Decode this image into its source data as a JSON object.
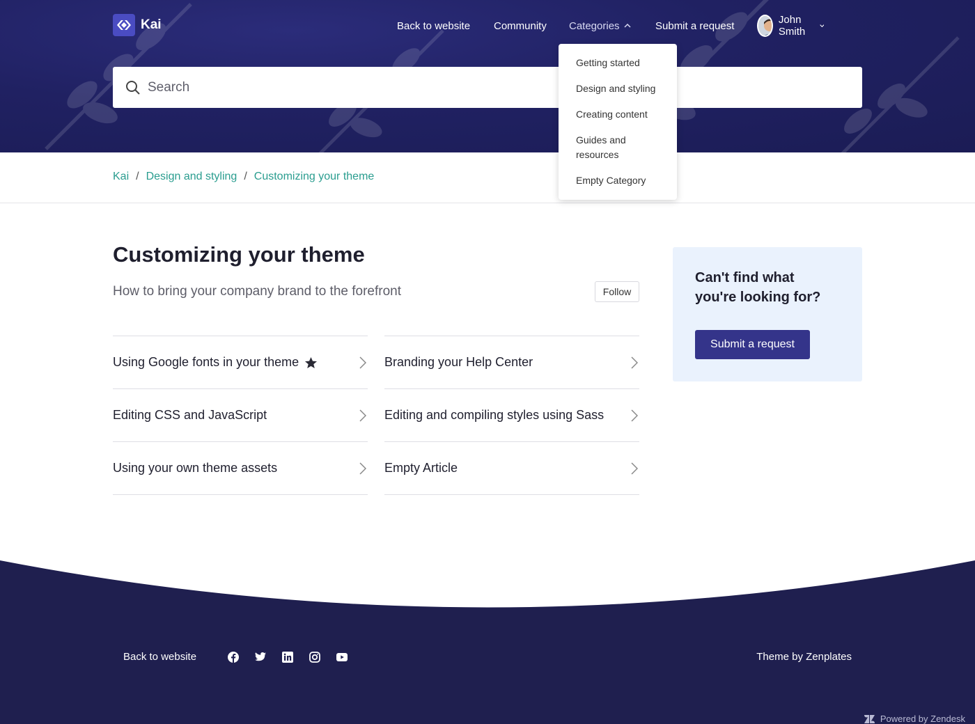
{
  "brand": {
    "name": "Kai"
  },
  "nav": {
    "back_to_website": "Back to website",
    "community": "Community",
    "categories": "Categories",
    "submit_request": "Submit a request",
    "user_name": "John Smith"
  },
  "search": {
    "placeholder": "Search"
  },
  "categories_menu": {
    "items": [
      "Getting started",
      "Design and styling",
      "Creating content",
      "Guides and resources",
      "Empty Category"
    ]
  },
  "breadcrumb": [
    "Kai",
    "Design and styling",
    "Customizing your theme"
  ],
  "section": {
    "title": "Customizing your theme",
    "description": "How to bring your company brand to the forefront",
    "follow_label": "Follow"
  },
  "articles": [
    {
      "title": "Using Google fonts in your theme",
      "promoted": true
    },
    {
      "title": "Branding your Help Center",
      "promoted": false
    },
    {
      "title": "Editing CSS and JavaScript",
      "promoted": false
    },
    {
      "title": "Editing and compiling styles using Sass",
      "promoted": false
    },
    {
      "title": "Using your own theme assets",
      "promoted": false
    },
    {
      "title": "Empty Article",
      "promoted": false
    }
  ],
  "help_card": {
    "title": "Can't find what you're looking for?",
    "button": "Submit a request"
  },
  "footer": {
    "back_to_website": "Back to website",
    "social_icons": [
      "facebook-icon",
      "twitter-icon",
      "linkedin-icon",
      "instagram-icon",
      "youtube-icon"
    ],
    "theme_by": "Theme by Zenplates",
    "powered_by": "Powered by Zendesk"
  },
  "colors": {
    "hero": "#202162",
    "footer": "#1f1f4f",
    "link": "#2a9d8f",
    "button": "#34348a",
    "card": "#eaf2fd"
  }
}
